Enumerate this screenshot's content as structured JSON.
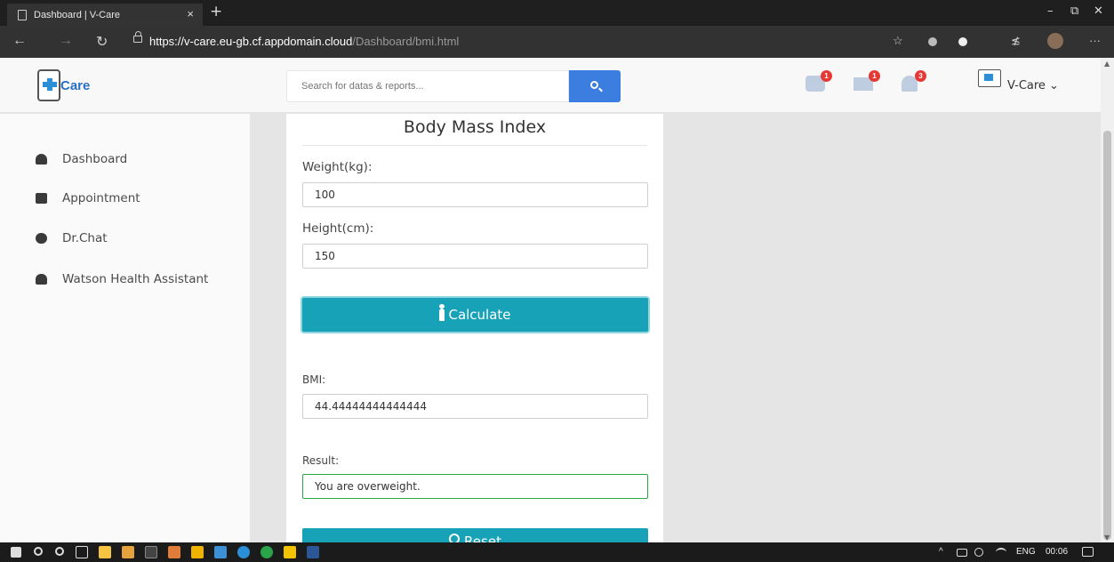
{
  "browser": {
    "tab_title": "Dashboard | V-Care",
    "tab_close": "×",
    "new_tab": "+",
    "min": "–",
    "restore": "⧉",
    "close": "✕",
    "back": "←",
    "forward": "→",
    "reload": "↻",
    "url_host": "https://v-care.eu-gb.cf.appdomain.cloud",
    "url_path": "/Dashboard/bmi.html",
    "favorite_star": "☆",
    "favorites": "≴",
    "more": "···"
  },
  "header": {
    "logo_text": "Care",
    "search_placeholder": "Search for datas & reports...",
    "messages_badge": "1",
    "mail_badge": "1",
    "alerts_badge": "3",
    "profile_name": "V-Care ⌄"
  },
  "sidebar": {
    "items": [
      {
        "label": "Dashboard",
        "icon": "tachometer-icon"
      },
      {
        "label": "Appointment",
        "icon": "calendar-icon"
      },
      {
        "label": "Dr.Chat",
        "icon": "chat-icon"
      },
      {
        "label": "Watson Health Assistant",
        "icon": "user-icon"
      }
    ]
  },
  "bmi_form": {
    "title": "Body Mass Index",
    "weight_label": "Weight(kg):",
    "weight_value": "100",
    "height_label": "Height(cm):",
    "height_value": "150",
    "calculate_label": "Calculate",
    "bmi_label": "BMI:",
    "bmi_value": "44.44444444444444",
    "result_label": "Result:",
    "result_value": "You are overweight.",
    "reset_label": "Reset"
  },
  "taskbar": {
    "tray": "^",
    "language": "ENG",
    "time": "00:06"
  },
  "colors": {
    "accent": "#17a2b8",
    "search_button": "#3c7de0",
    "badge": "#e53935",
    "success_border": "#28a745"
  }
}
